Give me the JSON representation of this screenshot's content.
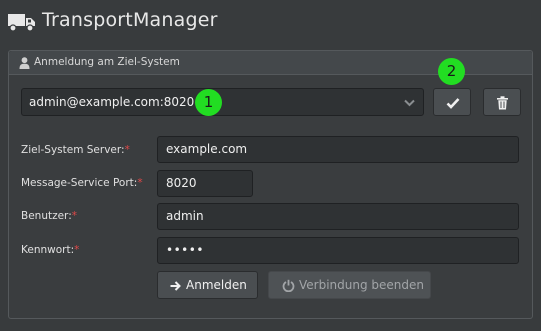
{
  "app": {
    "title": "TransportManager",
    "icon": "truck-icon"
  },
  "panel": {
    "title": "Anmeldung am Ziel-System",
    "icon": "user-icon"
  },
  "connection_select": {
    "value": "admin@example.com:8020",
    "icon": "chevron-down-icon"
  },
  "buttons": {
    "confirm_icon": "check-icon",
    "delete_icon": "trash-icon",
    "login_label": "Anmelden",
    "login_icon": "arrow-right-icon",
    "disconnect_label": "Verbindung beenden",
    "disconnect_icon": "power-icon"
  },
  "markers": {
    "one": "1",
    "two": "2",
    "color": "#22dd22"
  },
  "form": {
    "server": {
      "label": "Ziel-System Server:",
      "required": "*",
      "value": "example.com"
    },
    "port": {
      "label": "Message-Service Port:",
      "required": "*",
      "value": "8020"
    },
    "user": {
      "label": "Benutzer:",
      "required": "*",
      "value": "admin"
    },
    "password": {
      "label": "Kennwort:",
      "required": "*",
      "value": "•••••"
    }
  },
  "colors": {
    "background": "#383b3d",
    "required": "#e04848"
  }
}
